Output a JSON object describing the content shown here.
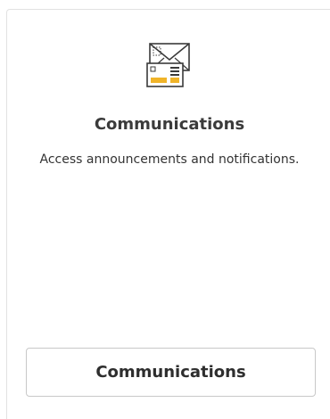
{
  "card": {
    "icon": "mail-envelope-icon",
    "title": "Communications",
    "description": "Access announcements and notifications.",
    "button_label": "Communications"
  },
  "colors": {
    "accent": "#f0b429",
    "title_text": "#3b3b3b",
    "border": "#c8c8c8"
  }
}
